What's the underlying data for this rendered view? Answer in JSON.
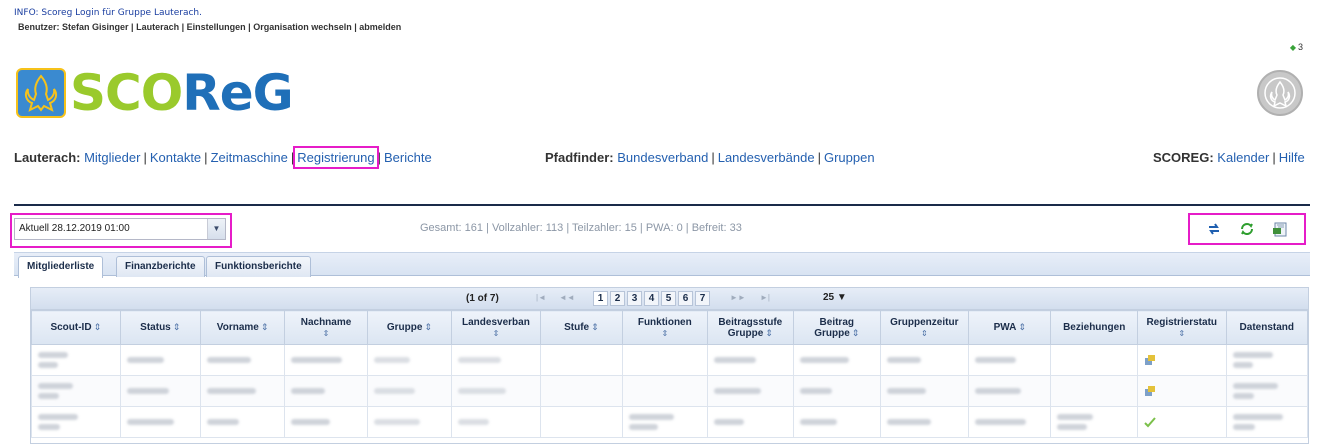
{
  "info_text": "INFO: Scoreg Login für Gruppe Lauterach.",
  "user_bar": {
    "prefix": "Benutzer: Stefan Gisinger",
    "items": [
      "Lauterach",
      "Einstellungen",
      "Organisation wechseln",
      "abmelden"
    ]
  },
  "counter": "3",
  "logo_text": {
    "sco": "SCO",
    "reg": "ReG"
  },
  "nav": {
    "lauterach": {
      "title": "Lauterach:",
      "links": [
        "Mitglieder",
        "Kontakte",
        "Zeitmaschine",
        "Registrierung",
        "Berichte"
      ]
    },
    "pfadfinder": {
      "title": "Pfadfinder:",
      "links": [
        "Bundesverband",
        "Landesverbände",
        "Gruppen"
      ]
    },
    "scoreg": {
      "title": "SCOREG:",
      "links": [
        "Kalender",
        "Hilfe"
      ]
    }
  },
  "date_select": {
    "value": "Aktuell 28.12.2019 01:00"
  },
  "stats_text": "Gesamt: 161 | Vollzahler: 113 | Teilzahler: 15 | PWA: 0 | Befreit: 33",
  "toolbar_icons": [
    "refresh-arrows-icon",
    "sync-green-icon",
    "export-icon"
  ],
  "tabs": [
    "Mitgliederliste",
    "Finanzberichte",
    "Funktionsberichte"
  ],
  "pager": {
    "current": "(1 of 7)",
    "pages": [
      "1",
      "2",
      "3",
      "4",
      "5",
      "6",
      "7"
    ],
    "per_page": "25 ▼",
    "first": "|◄",
    "prev": "◄◄",
    "next": "►►",
    "last": "►|"
  },
  "columns": [
    {
      "label": "Scout-ID",
      "sort": "inline"
    },
    {
      "label": "Status",
      "sort": "inline"
    },
    {
      "label": "Vorname",
      "sort": "inline"
    },
    {
      "label": "Nachname",
      "sort": "below"
    },
    {
      "label": "Gruppe",
      "sort": "inline"
    },
    {
      "label": "Landesverban",
      "sort": "below"
    },
    {
      "label": "Stufe",
      "sort": "inline"
    },
    {
      "label": "Funktionen",
      "sort": "below"
    },
    {
      "label": "Beitragsstufe Gruppe",
      "sort": "inline2"
    },
    {
      "label": "Beitrag Gruppe",
      "sort": "inline2"
    },
    {
      "label": "Gruppenzeitur",
      "sort": "below"
    },
    {
      "label": "PWA",
      "sort": "inline"
    },
    {
      "label": "Beziehungen",
      "sort": "none"
    },
    {
      "label": "Registrierstatu",
      "sort": "below"
    },
    {
      "label": "Datenstand",
      "sort": "none"
    }
  ],
  "sort_glyph": "⇕",
  "row_count": 3
}
